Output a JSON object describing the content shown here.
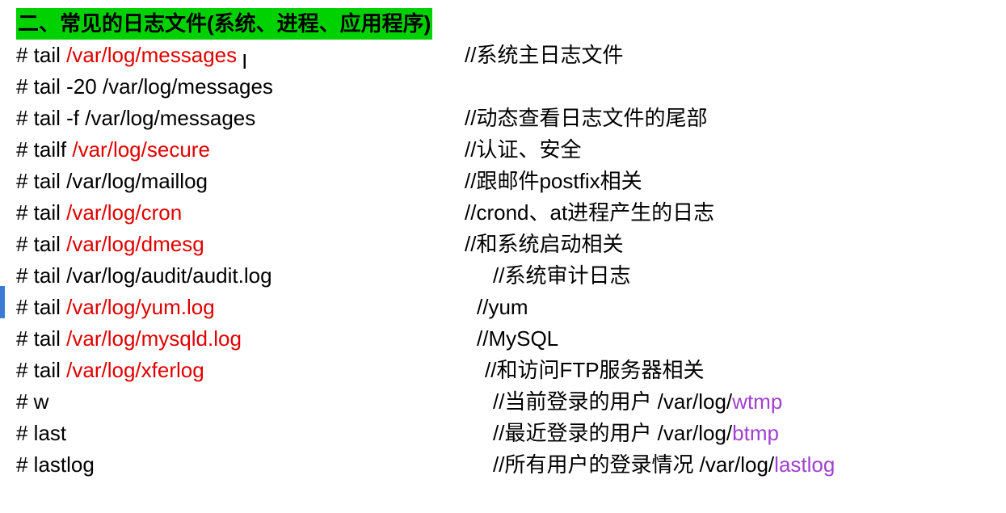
{
  "heading": "二、常见的日志文件(系统、进程、应用程序)",
  "lines": [
    {
      "left": [
        {
          "t": "# tail ",
          "c": ""
        },
        {
          "t": "/var/log/messages",
          "c": "red"
        },
        {
          "t": " I",
          "c": "cursor"
        }
      ],
      "pad": 555,
      "comment": [
        {
          "t": "//系统主日志文件",
          "c": ""
        }
      ]
    },
    {
      "left": [
        {
          "t": "# tail -20 /var/log/messages",
          "c": ""
        }
      ],
      "pad": 0,
      "comment": []
    },
    {
      "left": [
        {
          "t": "# tail -f /var/log/messages",
          "c": ""
        }
      ],
      "pad": 555,
      "comment": [
        {
          "t": "//动态查看日志文件的尾部",
          "c": ""
        }
      ]
    },
    {
      "left": [
        {
          "t": "# tailf ",
          "c": ""
        },
        {
          "t": "/var/log/secure",
          "c": "red"
        }
      ],
      "pad": 555,
      "comment": [
        {
          "t": "//认证、安全",
          "c": ""
        }
      ]
    },
    {
      "left": [
        {
          "t": "# tail /var/log/maillog",
          "c": ""
        }
      ],
      "pad": 555,
      "comment": [
        {
          "t": "//跟邮件postfix相关",
          "c": ""
        }
      ]
    },
    {
      "left": [
        {
          "t": "# tail ",
          "c": ""
        },
        {
          "t": "/var/log/cron",
          "c": "red"
        }
      ],
      "pad": 555,
      "comment": [
        {
          "t": "//crond、at进程产生的日志",
          "c": ""
        }
      ]
    },
    {
      "left": [
        {
          "t": "# tail ",
          "c": ""
        },
        {
          "t": "/var/log/dmesg",
          "c": "red"
        }
      ],
      "pad": 555,
      "comment": [
        {
          "t": "//和系统启动相关",
          "c": ""
        }
      ]
    },
    {
      "left": [
        {
          "t": "# tail /var/log/audit/audit.log",
          "c": ""
        }
      ],
      "pad": 590,
      "comment": [
        {
          "t": "//系统审计日志",
          "c": ""
        }
      ]
    },
    {
      "left": [
        {
          "t": "# tail ",
          "c": ""
        },
        {
          "t": "/var/log/yum.log",
          "c": "red"
        }
      ],
      "pad": 570,
      "comment": [
        {
          "t": "//yum",
          "c": ""
        }
      ]
    },
    {
      "left": [
        {
          "t": "# tail ",
          "c": ""
        },
        {
          "t": "/var/log/mysqld.log",
          "c": "red"
        }
      ],
      "pad": 570,
      "comment": [
        {
          "t": "//MySQL",
          "c": ""
        }
      ]
    },
    {
      "left": [
        {
          "t": "# tail ",
          "c": ""
        },
        {
          "t": "/var/log/xferlog",
          "c": "red"
        }
      ],
      "pad": 580,
      "comment": [
        {
          "t": "//和访问FTP服务器相关",
          "c": ""
        }
      ]
    },
    {
      "left": [
        {
          "t": "# w",
          "c": ""
        }
      ],
      "pad": 590,
      "comment": [
        {
          "t": "//当前登录的用户 /var/log/",
          "c": ""
        },
        {
          "t": "wtmp",
          "c": "purple"
        }
      ]
    },
    {
      "left": [
        {
          "t": "# last",
          "c": ""
        }
      ],
      "pad": 590,
      "comment": [
        {
          "t": "//最近登录的用户 /var/log/",
          "c": ""
        },
        {
          "t": "btmp",
          "c": "purple"
        }
      ]
    },
    {
      "left": [
        {
          "t": "# lastlog",
          "c": ""
        }
      ],
      "pad": 590,
      "comment": [
        {
          "t": "//所有用户的登录情况 /var/log/",
          "c": ""
        },
        {
          "t": "lastlog",
          "c": "purple"
        }
      ]
    }
  ]
}
